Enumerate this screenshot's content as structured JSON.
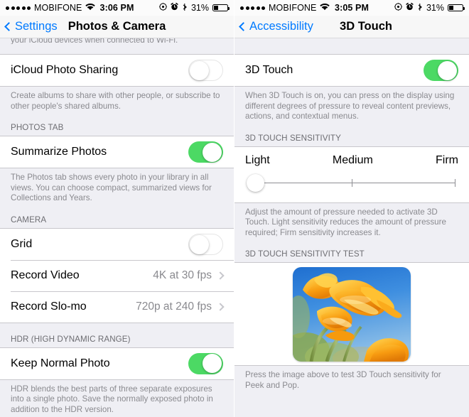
{
  "statusbar": {
    "carrier": "MOBIFONE",
    "signal_dots": 5,
    "wifi_icon": "wifi-icon",
    "time_left": "3:06 PM",
    "time_right": "3:05 PM",
    "location_icon": "location-services-icon",
    "alarm_icon": "alarm-clock-icon",
    "bluetooth_icon": "bluetooth-icon",
    "battery_percent": "31%",
    "battery_icon": "battery-icon"
  },
  "left_screen": {
    "nav": {
      "back_label": "Settings",
      "back_icon": "chevron-left-icon",
      "title": "Photos & Camera"
    },
    "clipped_footer": "your iCloud devices when connected to Wi-Fi.",
    "sections": [
      {
        "header": "",
        "rows": [
          {
            "label": "iCloud Photo Sharing",
            "type": "toggle",
            "state": "off"
          }
        ],
        "footer": "Create albums to share with other people, or subscribe to other people's shared albums."
      },
      {
        "header": "PHOTOS TAB",
        "rows": [
          {
            "label": "Summarize Photos",
            "type": "toggle",
            "state": "on"
          }
        ],
        "footer": "The Photos tab shows every photo in your library in all views. You can choose compact, summarized views for Collections and Years."
      },
      {
        "header": "CAMERA",
        "rows": [
          {
            "label": "Grid",
            "type": "toggle",
            "state": "off"
          },
          {
            "label": "Record Video",
            "type": "disclosure",
            "value": "4K at 30 fps"
          },
          {
            "label": "Record Slo-mo",
            "type": "disclosure",
            "value": "720p at 240 fps"
          }
        ],
        "footer": ""
      },
      {
        "header": "HDR (HIGH DYNAMIC RANGE)",
        "rows": [
          {
            "label": "Keep Normal Photo",
            "type": "toggle",
            "state": "on"
          }
        ],
        "footer": "HDR blends the best parts of three separate exposures into a single photo. Save the normally exposed photo in addition to the HDR version."
      }
    ]
  },
  "right_screen": {
    "nav": {
      "back_label": "Accessibility",
      "back_icon": "chevron-left-icon",
      "title": "3D Touch"
    },
    "sections": [
      {
        "header": "",
        "rows": [
          {
            "label": "3D Touch",
            "type": "toggle",
            "state": "on"
          }
        ],
        "footer": "When 3D Touch is on, you can press on the display using different degrees of pressure to reveal content previews, actions, and contextual menus."
      },
      {
        "header": "3D TOUCH SENSITIVITY",
        "slider": {
          "labels": [
            "Light",
            "Medium",
            "Firm"
          ],
          "value": 0,
          "min": 0,
          "max": 2
        },
        "footer": "Adjust the amount of pressure needed to activate 3D Touch. Light sensitivity reduces the amount of pressure required; Firm sensitivity increases it."
      },
      {
        "header": "3D TOUCH SENSITIVITY TEST",
        "photo_alt": "orange-poppy-flowers-photo",
        "footer": "Press the image above to test 3D Touch sensitivity for Peek and Pop."
      }
    ]
  },
  "colors": {
    "accent_blue": "#007aff",
    "toggle_on_green": "#4cd964",
    "group_bg": "#efeff4",
    "cell_bg": "#ffffff",
    "separator": "#c8c7cc",
    "secondary_text": "#8a8a8f"
  }
}
